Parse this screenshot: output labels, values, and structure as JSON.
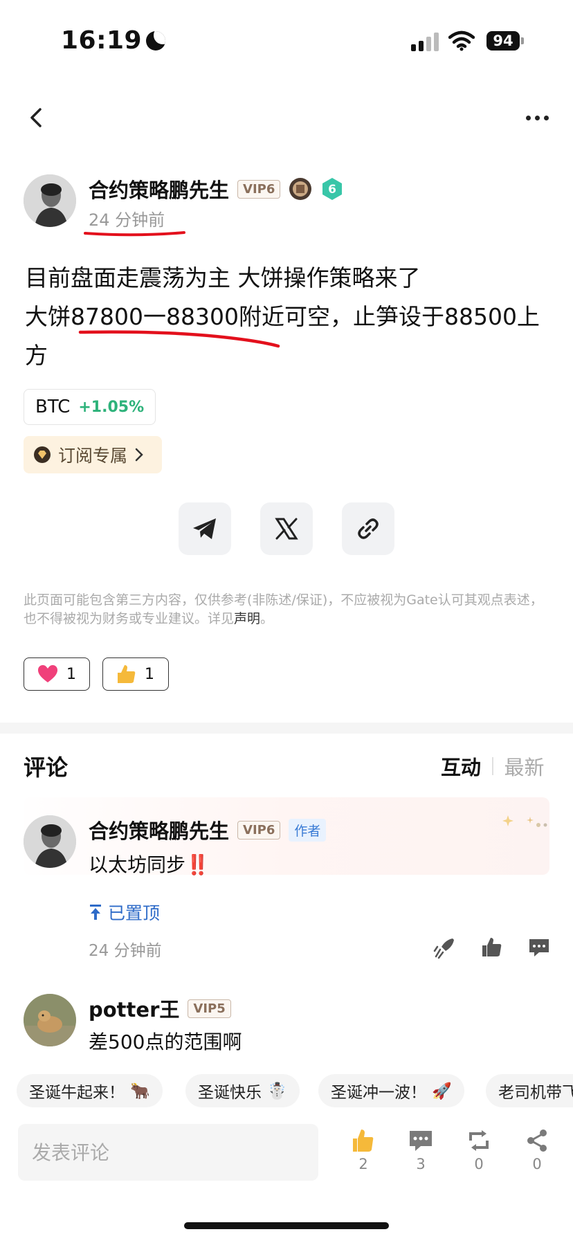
{
  "status": {
    "time": "16:19",
    "battery": "94"
  },
  "post": {
    "author": "合约策略鹏先生",
    "vip": "VIP6",
    "level": "6",
    "time": "24 分钟前",
    "lines": [
      "目前盘面走震荡为主 大饼操作策略来了",
      "大饼87800一88300附近可空，止笋设于88500上方"
    ],
    "ticker": {
      "symbol": "BTC",
      "change": "+1.05%"
    },
    "subscribe_label": "订阅专属",
    "disclaimer": "此页面可能包含第三方内容，仅供参考(非陈述/保证)，不应被视为Gate认可其观点表述，也不得被视为财务或专业建议。详见",
    "disclaimer_link": "声明",
    "disclaimer_end": "。",
    "reactions": [
      {
        "icon": "heart-icon",
        "count": "1"
      },
      {
        "icon": "thumb-icon",
        "count": "1"
      }
    ]
  },
  "comments": {
    "title": "评论",
    "sort_active": "互动",
    "sort_inactive": "最新",
    "items": [
      {
        "name": "合约策略鹏先生",
        "vip": "VIP6",
        "author_tag": "作者",
        "text": "以太坊同步",
        "emoji": "‼️",
        "pinned_label": "已置顶",
        "time": "24 分钟前"
      },
      {
        "name": "potter王",
        "vip": "VIP5",
        "text": "差500点的范围啊"
      }
    ]
  },
  "chips": [
    {
      "label": "圣诞牛起来！",
      "emoji": "🐂"
    },
    {
      "label": "圣诞快乐",
      "emoji": "☃️"
    },
    {
      "label": "圣诞冲一波！",
      "emoji": "🚀"
    },
    {
      "label": "老司机带飞"
    }
  ],
  "bottom_bar": {
    "placeholder": "发表评论",
    "like_count": "2",
    "comment_count": "3",
    "repost_count": "0",
    "share_count": "0"
  }
}
